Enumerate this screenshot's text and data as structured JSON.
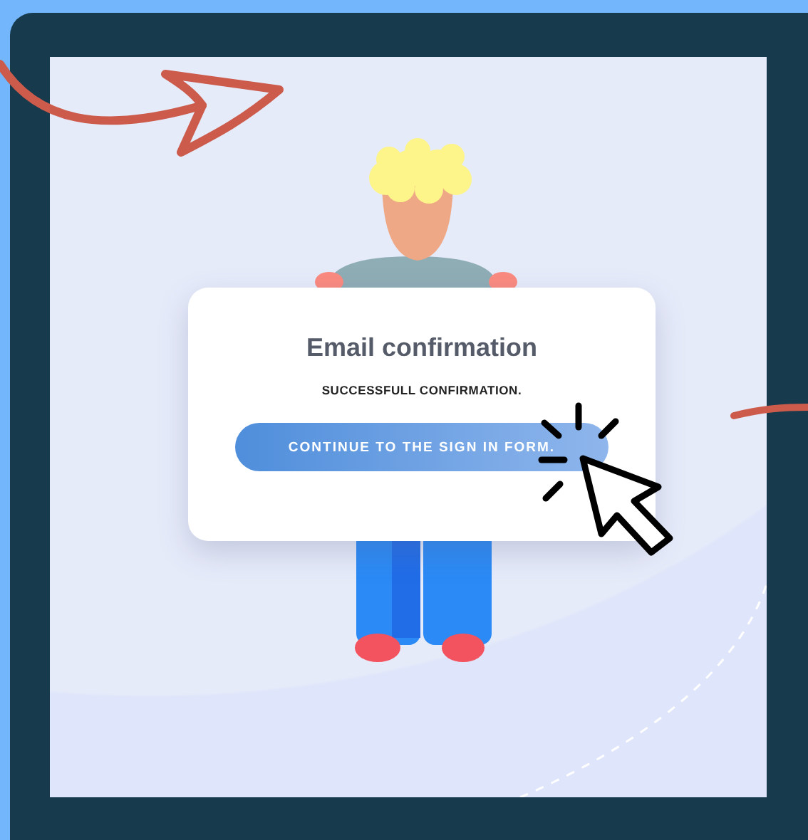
{
  "card": {
    "title": "Email confirmation",
    "message": "SUCCESSFULL CONFIRMATION.",
    "button": "CONTINUE TO THE SIGN IN FORM."
  }
}
